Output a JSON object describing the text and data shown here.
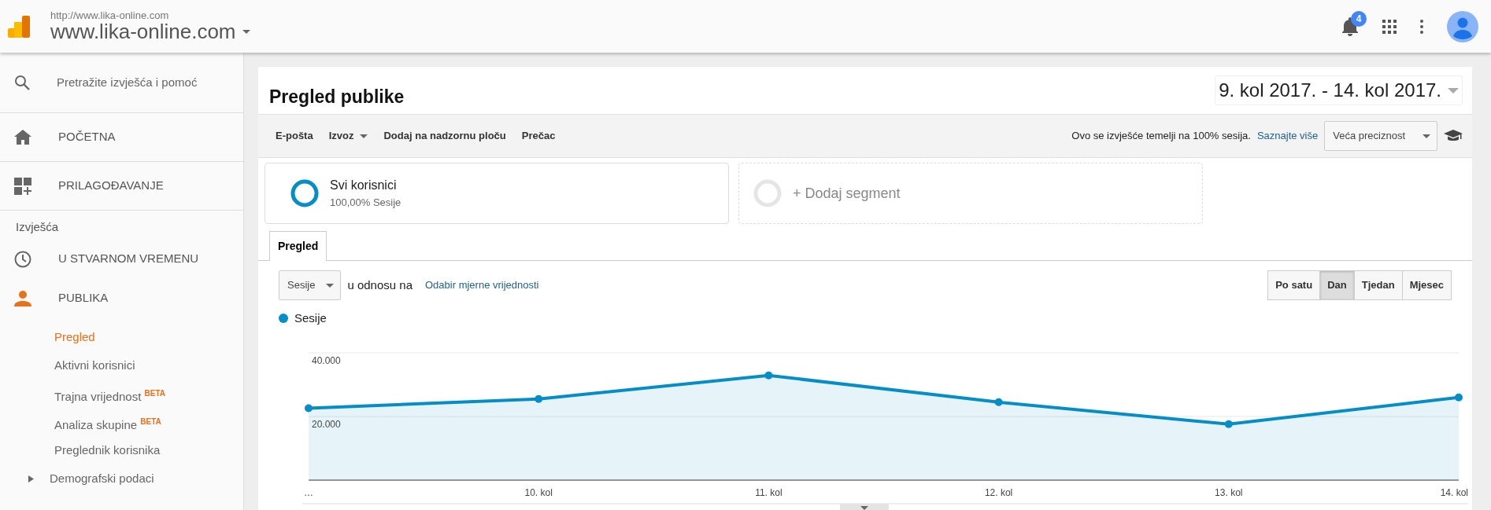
{
  "header": {
    "url": "http://www.lika-online.com",
    "property": "www.lika-online.com",
    "notifications": "4"
  },
  "sidebar": {
    "search_placeholder": "Pretražite izvješća i pomoć",
    "top_items": [
      {
        "label": "POČETNA",
        "selected": false
      },
      {
        "label": "PRILAGOĐAVANJE",
        "selected": false
      }
    ],
    "section": "Izvješća",
    "report_items": [
      {
        "label": "U STVARNOM VREMENU",
        "selected": false
      },
      {
        "label": "PUBLIKA",
        "selected": true
      }
    ],
    "sub_items": [
      {
        "label": "Pregled",
        "selected": true
      },
      {
        "label": "Aktivni korisnici",
        "selected": false
      },
      {
        "label": "Trajna vrijednost",
        "badge": "BETA",
        "selected": false
      },
      {
        "label": "Analiza skupine",
        "badge": "BETA",
        "selected": false
      },
      {
        "label": "Preglednik korisnika",
        "selected": false
      },
      {
        "label": "Demografski podaci",
        "expanded": false,
        "selected": false
      }
    ]
  },
  "report": {
    "title": "Pregled publike",
    "date_range": "9. kol 2017. - 14. kol 2017.",
    "toolbar": [
      {
        "label": "E-pošta",
        "dropdown": false
      },
      {
        "label": "Izvoz",
        "dropdown": true
      },
      {
        "label": "Dodaj na nadzornu ploču",
        "dropdown": false
      },
      {
        "label": "Prečac",
        "dropdown": false
      }
    ],
    "sampling_text": "Ovo se izvješće temelji na 100% sesija.",
    "learn_more": "Saznajte više",
    "precision": "Veća preciznost",
    "segments": [
      {
        "kind": "active",
        "name": "Svi korisnici",
        "detail": "100,00% Sesije"
      },
      {
        "kind": "add",
        "name": "+ Dodaj segment"
      }
    ],
    "tabs": [
      {
        "label": "Pregled",
        "selected": true
      }
    ],
    "metric": "Sesije",
    "versus": "u odnosu na",
    "pick_metric": "Odabir mjerne vrijednosti",
    "timescale": [
      {
        "label": "Po satu",
        "selected": false
      },
      {
        "label": "Dan",
        "selected": true
      },
      {
        "label": "Tjedan",
        "selected": false
      },
      {
        "label": "Mjesec",
        "selected": false
      }
    ],
    "chart_data": {
      "type": "area",
      "categories": [
        "…",
        "10. kol",
        "11. kol",
        "12. kol",
        "13. kol",
        "14. kol"
      ],
      "series": [
        {
          "name": "Sesije",
          "color": "#058dc7",
          "values": [
            22600,
            25500,
            32900,
            24500,
            17600,
            26000
          ]
        }
      ],
      "ylim": [
        0,
        40000
      ],
      "yticks": [
        {
          "value": 20000,
          "label": "20.000"
        },
        {
          "value": 40000,
          "label": "40.000"
        }
      ]
    }
  }
}
